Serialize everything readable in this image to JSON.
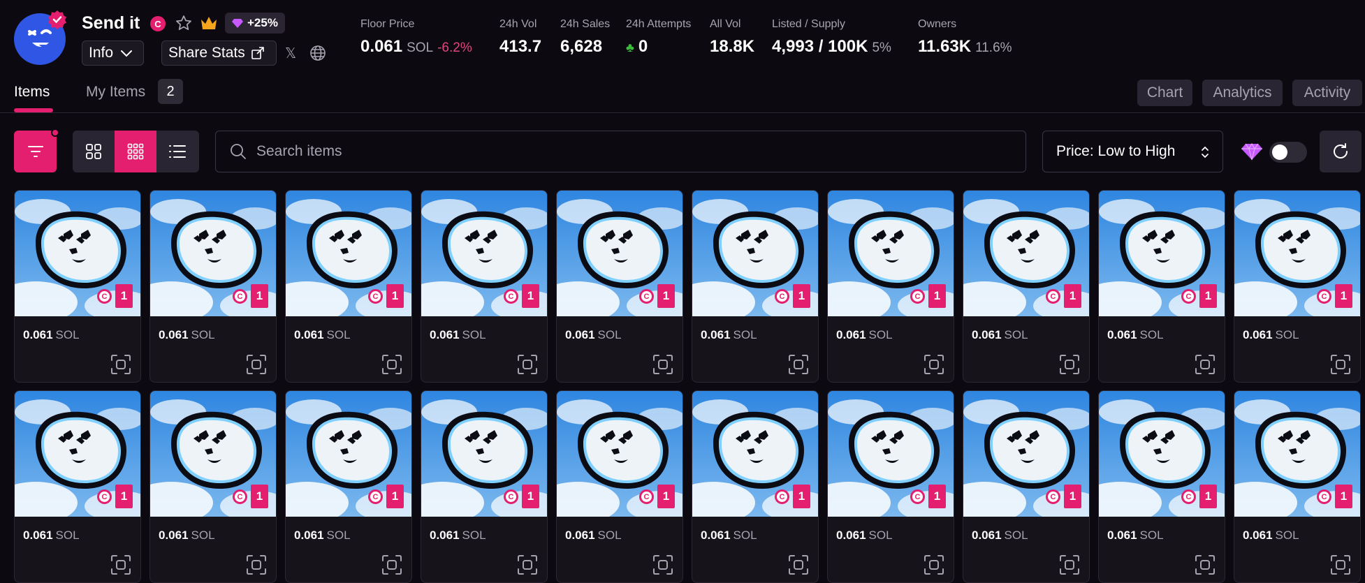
{
  "collection": {
    "name": "Send it",
    "creator_badge": "C",
    "boost": "+25%"
  },
  "header": {
    "info_label": "Info",
    "share_label": "Share Stats",
    "x_label": "𝕏"
  },
  "stats": {
    "floor": {
      "label": "Floor Price",
      "value": "0.061",
      "unit": "SOL",
      "change": "-6.2%"
    },
    "vol24": {
      "label": "24h Vol",
      "value": "413.7"
    },
    "sales24": {
      "label": "24h Sales",
      "value": "6,628"
    },
    "attempts24": {
      "label": "24h Attempts",
      "value": "0"
    },
    "allvol": {
      "label": "All Vol",
      "value": "18.8K"
    },
    "listed": {
      "label": "Listed / Supply",
      "value": "4,993 / 100K",
      "pct": "5%"
    },
    "owners": {
      "label": "Owners",
      "value": "11.63K",
      "pct": "11.6%"
    }
  },
  "tabs": {
    "items": "Items",
    "my_items": "My Items",
    "my_items_count": "2",
    "chart": "Chart",
    "analytics": "Analytics",
    "activity": "Activity"
  },
  "toolbar": {
    "search_placeholder": "Search items",
    "sort_value": "Price: Low to High"
  },
  "items": [
    {
      "price": "0.061",
      "unit": "SOL",
      "qty": "1",
      "badge": "C"
    },
    {
      "price": "0.061",
      "unit": "SOL",
      "qty": "1",
      "badge": "C"
    },
    {
      "price": "0.061",
      "unit": "SOL",
      "qty": "1",
      "badge": "C"
    },
    {
      "price": "0.061",
      "unit": "SOL",
      "qty": "1",
      "badge": "C"
    },
    {
      "price": "0.061",
      "unit": "SOL",
      "qty": "1",
      "badge": "C"
    },
    {
      "price": "0.061",
      "unit": "SOL",
      "qty": "1",
      "badge": "C"
    },
    {
      "price": "0.061",
      "unit": "SOL",
      "qty": "1",
      "badge": "C"
    },
    {
      "price": "0.061",
      "unit": "SOL",
      "qty": "1",
      "badge": "C"
    },
    {
      "price": "0.061",
      "unit": "SOL",
      "qty": "1",
      "badge": "C"
    },
    {
      "price": "0.061",
      "unit": "SOL",
      "qty": "1",
      "badge": "C"
    },
    {
      "price": "0.061",
      "unit": "SOL",
      "qty": "1",
      "badge": "C"
    },
    {
      "price": "0.061",
      "unit": "SOL",
      "qty": "1",
      "badge": "C"
    },
    {
      "price": "0.061",
      "unit": "SOL",
      "qty": "1",
      "badge": "C"
    },
    {
      "price": "0.061",
      "unit": "SOL",
      "qty": "1",
      "badge": "C"
    },
    {
      "price": "0.061",
      "unit": "SOL",
      "qty": "1",
      "badge": "C"
    },
    {
      "price": "0.061",
      "unit": "SOL",
      "qty": "1",
      "badge": "C"
    },
    {
      "price": "0.061",
      "unit": "SOL",
      "qty": "1",
      "badge": "C"
    },
    {
      "price": "0.061",
      "unit": "SOL",
      "qty": "1",
      "badge": "C"
    },
    {
      "price": "0.061",
      "unit": "SOL",
      "qty": "1",
      "badge": "C"
    },
    {
      "price": "0.061",
      "unit": "SOL",
      "qty": "1",
      "badge": "C"
    }
  ],
  "colors": {
    "accent": "#e51f6f",
    "background": "#0c0a10",
    "negative": "#e0457b",
    "clover": "#3bbf3b",
    "sky": "#2f86e0"
  },
  "icons": [
    "verified-badge-icon",
    "star-icon",
    "crown-icon",
    "gem-icon",
    "chevron-down-icon",
    "share-icon",
    "x-logo-icon",
    "globe-icon",
    "clover-icon",
    "filter-icon",
    "grid-large-icon",
    "grid-small-icon",
    "list-icon",
    "search-icon",
    "sort-chevrons-icon",
    "refresh-icon",
    "scan-icon"
  ]
}
